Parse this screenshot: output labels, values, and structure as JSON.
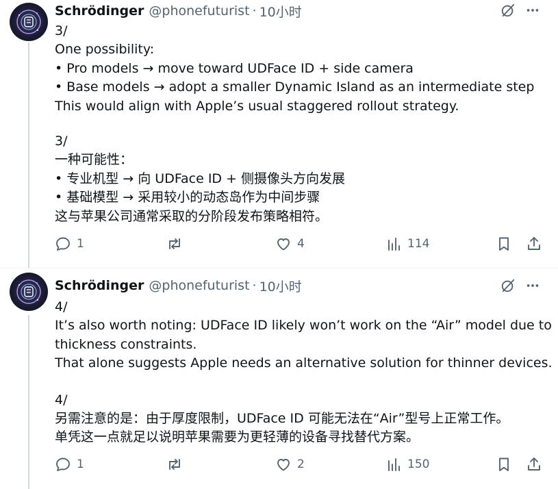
{
  "posts": [
    {
      "author": "Schrödinger",
      "handle": "@phonefuturist",
      "separator": "·",
      "time": "10小时",
      "lines": [
        "3/",
        "One possibility:",
        "• Pro models → move toward UDFace ID + side camera",
        "• Base models → adopt a smaller Dynamic Island as an intermediate step",
        "This would align with Apple’s usual staggered rollout strategy.",
        "",
        "3/",
        "一种可能性：",
        "• 专业机型 → 向 UDFace ID + 侧摄像头方向发展",
        "• 基础模型 → 采用较小的动态岛作为中间步骤",
        "这与苹果公司通常采取的分阶段发布策略相符。"
      ],
      "stats": {
        "replies": "1",
        "reposts": "",
        "likes": "4",
        "views": "114"
      }
    },
    {
      "author": "Schrödinger",
      "handle": "@phonefuturist",
      "separator": "·",
      "time": "10小时",
      "lines": [
        "4/",
        "It’s also worth noting: UDFace ID likely won’t work on the “Air” model due to",
        "thickness constraints.",
        "That alone suggests Apple needs an alternative solution for thinner devices.",
        "",
        "4/",
        "另需注意的是：由于厚度限制，UDFace ID 可能无法在“Air”型号上正常工作。",
        "单凭这一点就足以说明苹果需要为更轻薄的设备寻找替代方案。"
      ],
      "stats": {
        "replies": "1",
        "reposts": "",
        "likes": "2",
        "views": "150"
      }
    }
  ],
  "icons": {
    "grok": "grok-icon",
    "more": "more-icon",
    "reply": "reply-icon",
    "repost": "repost-icon",
    "like": "like-icon",
    "views": "views-icon",
    "bookmark": "bookmark-icon",
    "share": "share-icon"
  },
  "colors": {
    "text": "#0f1419",
    "secondary": "#536471",
    "thread_line": "#cfd9de"
  }
}
